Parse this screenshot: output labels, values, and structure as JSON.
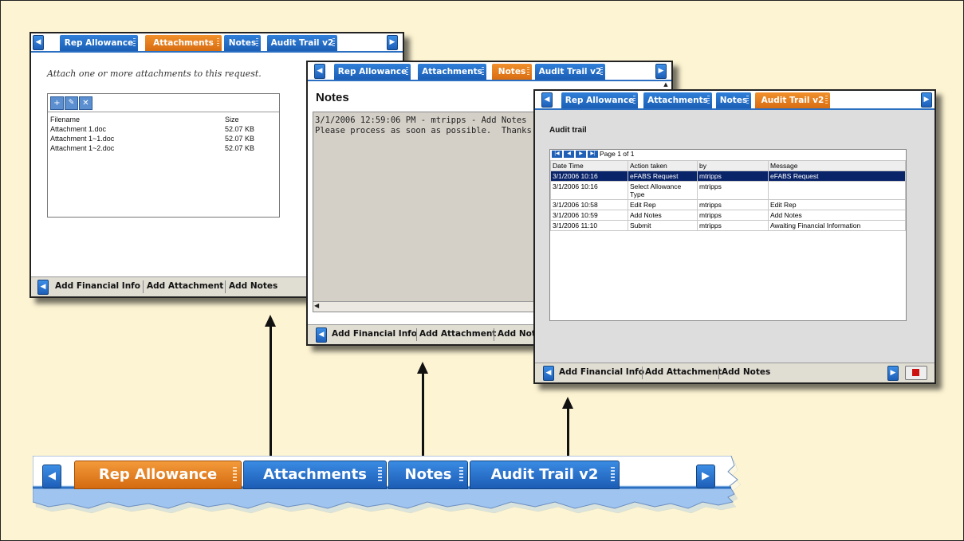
{
  "tabs": [
    "Rep Allowance",
    "Attachments",
    "Notes",
    "Audit Trail v2"
  ],
  "bottom_actions": [
    "Add Financial Info",
    "Add Attachment",
    "Add Notes"
  ],
  "attachments_window": {
    "instruction": "Attach one or more attachments to this request.",
    "columns": {
      "filename": "Filename",
      "size": "Size"
    },
    "files": [
      {
        "name": "Attachment 1.doc",
        "size": "52.07 KB"
      },
      {
        "name": "Attachment 1~1.doc",
        "size": "52.07 KB"
      },
      {
        "name": "Attachment 1~2.doc",
        "size": "52.07 KB"
      }
    ]
  },
  "notes_window": {
    "title": "Notes",
    "line1": "3/1/2006 12:59:06 PM - mtripps - Add Notes",
    "line2": "Please process as soon as possible.  Thanks, Em"
  },
  "audit_window": {
    "title": "Audit trail",
    "page_label": "Page 1 of 1",
    "columns": [
      "Date Time",
      "Action taken",
      "by",
      "Message"
    ],
    "rows": [
      {
        "date": "3/1/2006 10:16",
        "action": "eFABS Request",
        "by": "mtripps",
        "message": "eFABS Request"
      },
      {
        "date": "3/1/2006 10:16",
        "action": "Select Allowance Type",
        "by": "mtripps",
        "message": ""
      },
      {
        "date": "3/1/2006 10:58",
        "action": "Edit Rep",
        "by": "mtripps",
        "message": "Edit Rep"
      },
      {
        "date": "3/1/2006 10:59",
        "action": "Add Notes",
        "by": "mtripps",
        "message": "Add Notes"
      },
      {
        "date": "3/1/2006 11:10",
        "action": "Submit",
        "by": "mtripps",
        "message": "Awaiting Financial Information"
      }
    ]
  },
  "colors": {
    "background": "#fdf4d3",
    "tab_blue": "#1c5fb6",
    "tab_orange": "#d86d12",
    "selected_row": "#0a246a"
  }
}
